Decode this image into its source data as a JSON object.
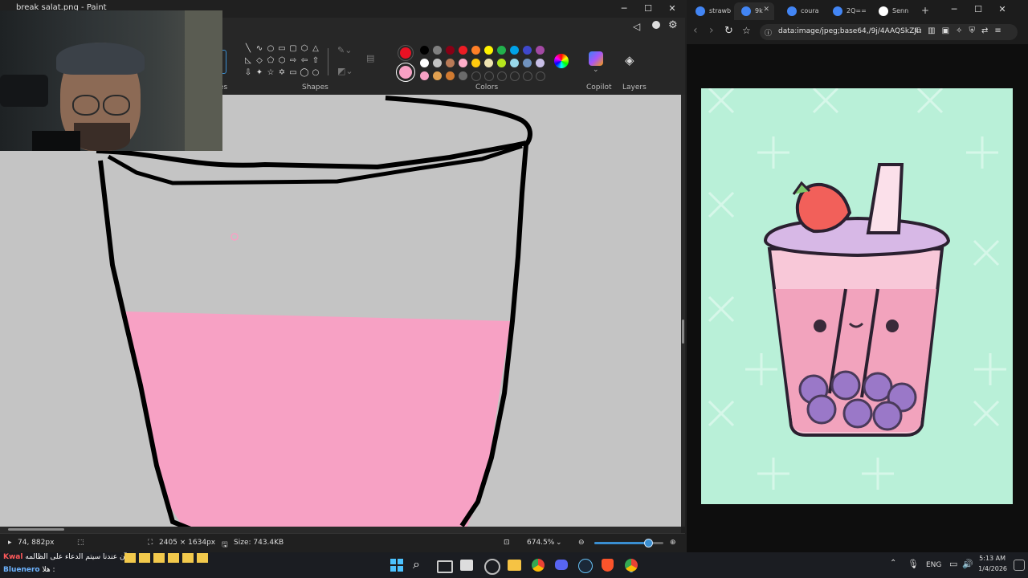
{
  "paint": {
    "title": "break salat.png - Paint",
    "sections": {
      "shapes": "Shapes",
      "colors": "Colors",
      "copilot": "Copilot",
      "layers": "Layers",
      "partial_label": "es"
    },
    "colors": {
      "primary": "#e81123",
      "secondary": "#f7a1c4",
      "palette_row1": [
        "#000000",
        "#7f7f7f",
        "#880015",
        "#ed1c24",
        "#ff7f27",
        "#fff200",
        "#22b14c",
        "#00a2e8",
        "#3f48cc",
        "#a349a4"
      ],
      "palette_row2": [
        "#ffffff",
        "#c3c3c3",
        "#b97a57",
        "#ffaec9",
        "#ffc90e",
        "#efe4b0",
        "#b5e61d",
        "#99d9ea",
        "#7092be",
        "#c8bfe7"
      ],
      "palette_row3": [
        "#f7a1c4",
        "#e0a050",
        "#d07a30",
        "#6b6b6b"
      ]
    },
    "status": {
      "cursor_pos": "74, 882px",
      "canvas_size": "2405 × 1634px",
      "file_size": "Size: 743.4KB",
      "zoom": "674.5%",
      "zoom_level_fraction": 0.78
    },
    "icons": {
      "minimize": "─",
      "maximize": "☐",
      "close": "✕",
      "settings": "⚙",
      "cursor": "▸",
      "select": "⬚",
      "resize": "⛶",
      "save": "🖫",
      "fit": "⊡",
      "zoom_out": "⊖",
      "zoom_in": "⊕",
      "copilot": "◆",
      "layers": "◈",
      "drop": "💧",
      "chevron": "⌄"
    }
  },
  "browser": {
    "tabs": [
      {
        "label": "strawb",
        "color": "#4285f4"
      },
      {
        "label": "9k",
        "color": "#4285f4",
        "active": true
      },
      {
        "label": "coura",
        "color": "#4285f4"
      },
      {
        "label": "2Q==",
        "color": "#4285f4"
      },
      {
        "label": "Senn",
        "color": "#ffffff"
      }
    ],
    "new_tab": "+",
    "url": "data:image/jpeg;base64,/9j/4AAQSkZJI",
    "icons": {
      "back": "‹",
      "forward": "›",
      "reload": "↻",
      "bookmark": "☆",
      "minimize": "─",
      "maximize": "☐",
      "close": "✕",
      "close_tab": "✕"
    }
  },
  "taskbar": {
    "chat_lines": [
      {
        "name": "Kwal",
        "text": "الآن عندنا سيتم الدعاء على الظالمه :"
      },
      {
        "name": "Bluenero",
        "text": "هلا :"
      }
    ],
    "tray": {
      "lang": "ENG",
      "time": "5:13 AM",
      "date": "1/4/2026",
      "chevron": "⌃"
    },
    "icons": {
      "search": "⌕",
      "start": "⊞"
    }
  }
}
